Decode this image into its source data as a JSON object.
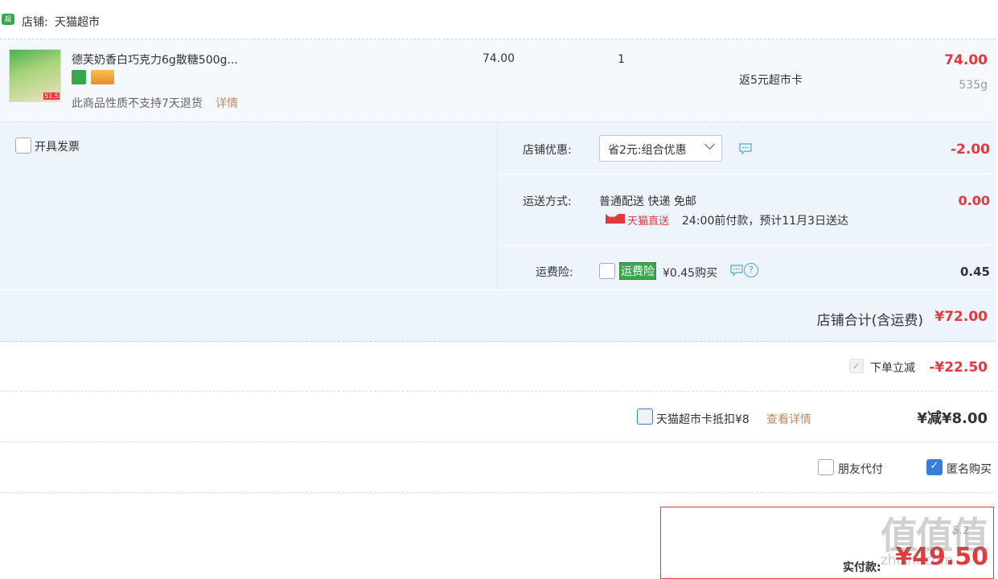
{
  "shop": {
    "label": "店铺:",
    "name": "天猫超市"
  },
  "item": {
    "title": "德芙奶香白巧克力6g散糖500g...",
    "unit_price": "74.00",
    "quantity": "1",
    "cashback": "返5元超市卡",
    "subtotal": "74.00",
    "weight": "535g",
    "return_policy": "此商品性质不支持7天退货",
    "detail_link": "详情",
    "thumb_tag": "51.5"
  },
  "invoice": {
    "label": "开具发票"
  },
  "shop_discount": {
    "label": "店铺优惠:",
    "selected": "省2元:组合优惠",
    "amount": "-2.00"
  },
  "shipping": {
    "label": "运送方式:",
    "method": "普通配送 快递 免邮",
    "badge": "天猫直送",
    "eta": "24:00前付款，预计11月3日送达",
    "amount": "0.00"
  },
  "insurance": {
    "label": "运费险:",
    "tag": "运费险",
    "price": "¥0.45购买",
    "amount": "0.45"
  },
  "shop_total": {
    "label": "店铺合计(含运费)",
    "amount": "¥72.00"
  },
  "instant_discount": {
    "label": "下单立减",
    "amount": "-¥22.50"
  },
  "card_deduct": {
    "label": "天猫超市卡抵扣¥8",
    "link": "查看详情",
    "amount": "¥减¥8.00"
  },
  "options": {
    "friend_pay": "朋友代付",
    "anonymous": "匿名购买"
  },
  "payment": {
    "label": "实付款:",
    "amount": "¥49.50",
    "watermark_hint": "5.2"
  },
  "watermark": {
    "text": "值值值",
    "site": "zhizhi.com"
  },
  "colors": {
    "accent": "#e4393c",
    "panel": "#eef4fb",
    "border": "#b9d3ee",
    "link": "#c08a5b",
    "green": "#3aa64b"
  }
}
